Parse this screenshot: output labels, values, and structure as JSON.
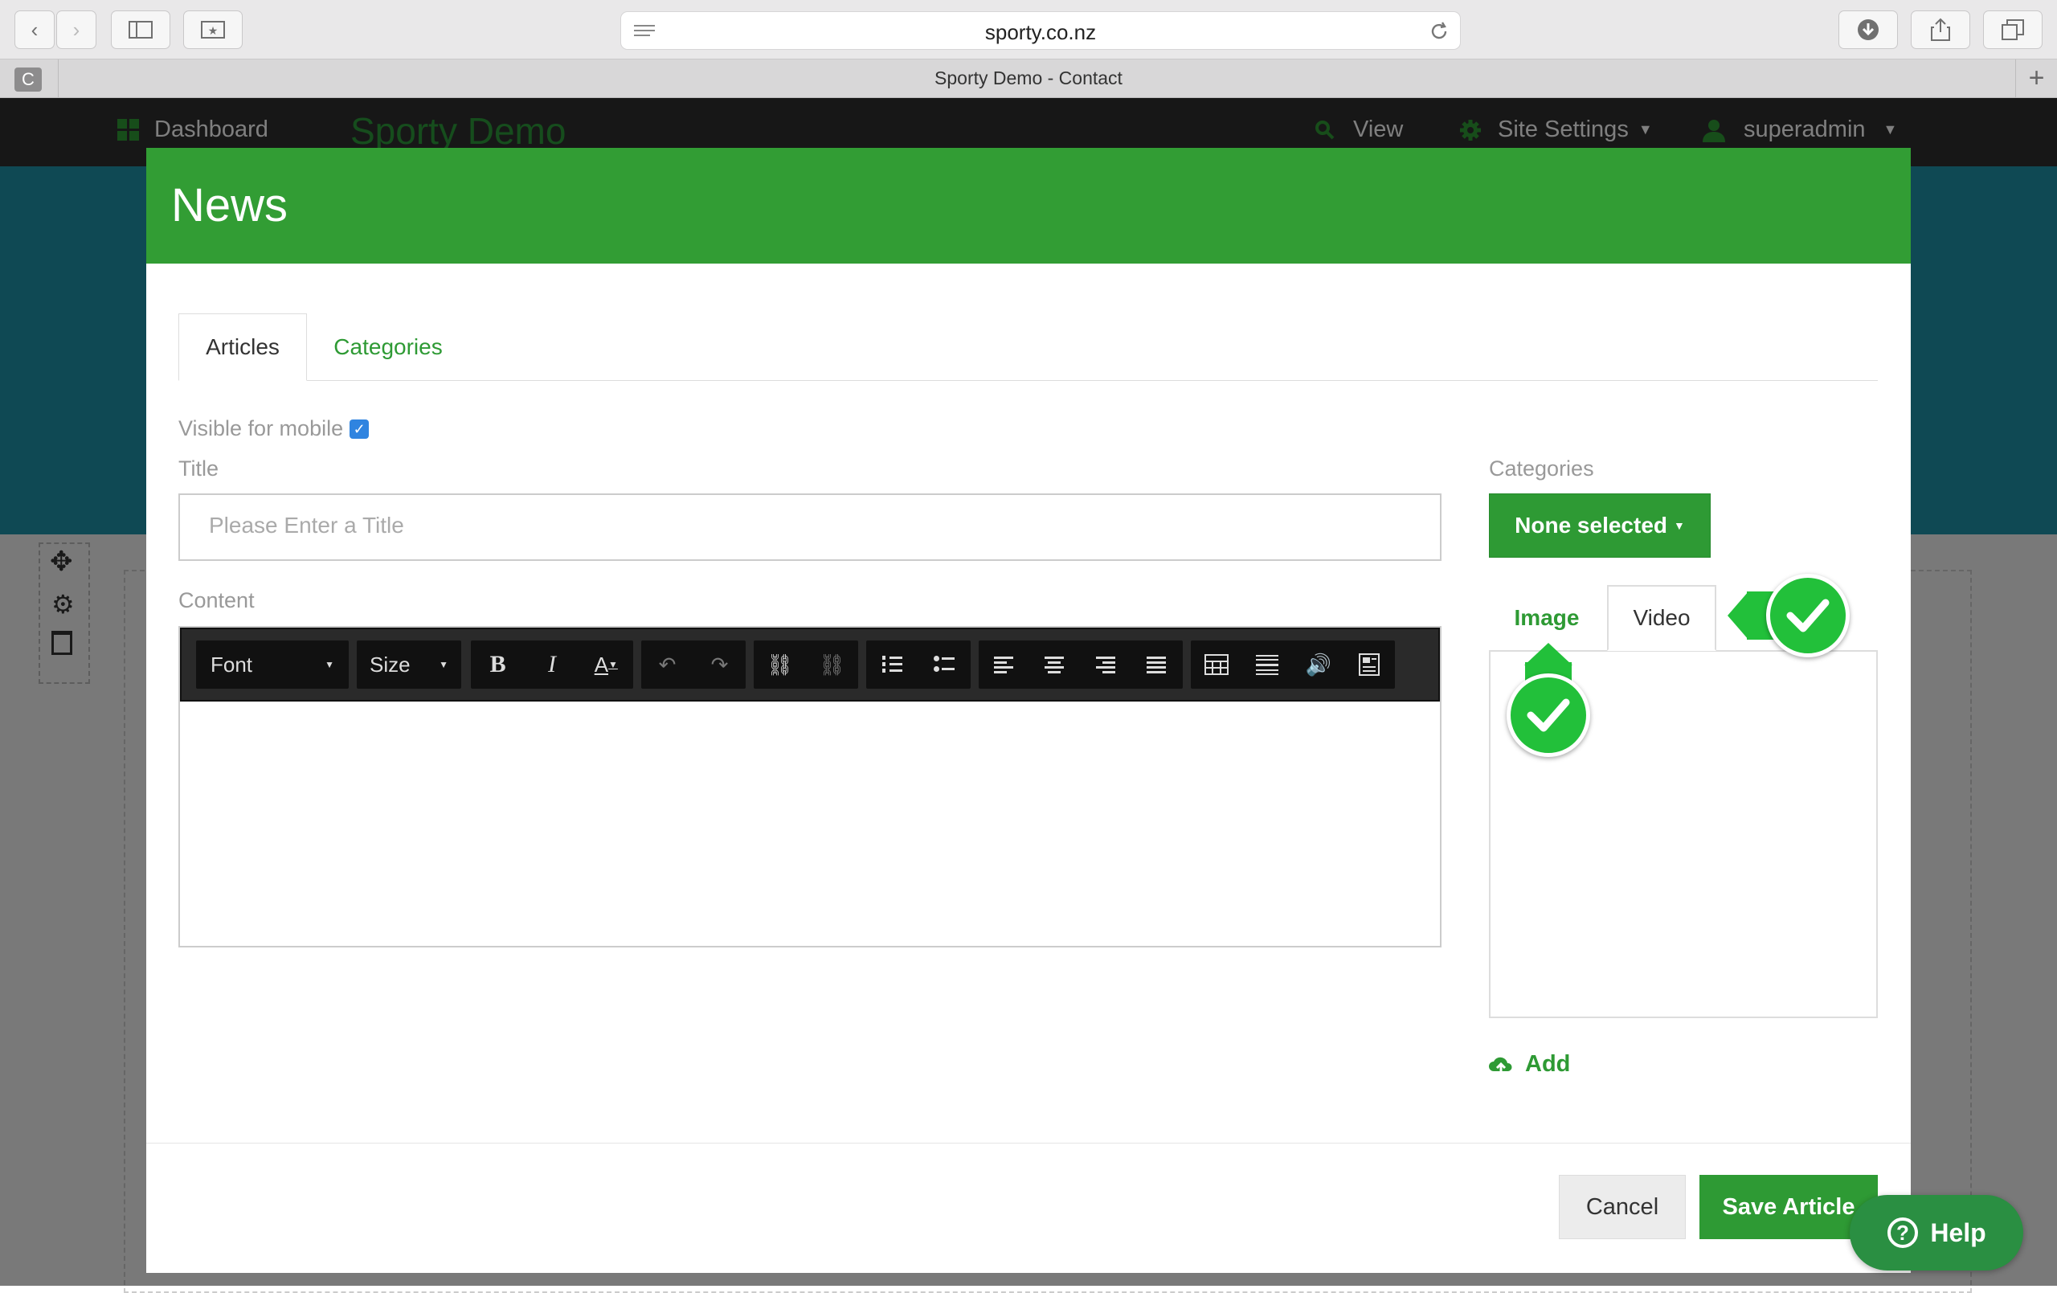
{
  "browser": {
    "url": "sporty.co.nz",
    "tab_title": "Sporty Demo - Contact",
    "tab_favicon_letter": "C"
  },
  "topbar": {
    "dashboard_label": "Dashboard",
    "brand": "Sporty Demo",
    "view_label": "View",
    "site_settings_label": "Site Settings",
    "user_label": "superadmin"
  },
  "modal": {
    "title": "News",
    "tabs": [
      {
        "label": "Articles",
        "active": true
      },
      {
        "label": "Categories",
        "active": false
      }
    ],
    "visible_mobile_label": "Visible for mobile",
    "visible_mobile_checked": true,
    "title_label": "Title",
    "title_placeholder": "Please Enter a Title",
    "content_label": "Content",
    "editor": {
      "font_label": "Font",
      "size_label": "Size"
    },
    "categories_label": "Categories",
    "categories_select": "None selected",
    "media_tabs": [
      {
        "label": "Image",
        "active": false
      },
      {
        "label": "Video",
        "active": true
      }
    ],
    "add_label": "Add",
    "cancel_label": "Cancel",
    "save_label": "Save Article"
  },
  "help_label": "Help",
  "colors": {
    "brand_green": "#329d34",
    "check_green": "#22c03a",
    "hero_teal": "#1f93a8",
    "topbar_dark": "#2f2f2f"
  }
}
